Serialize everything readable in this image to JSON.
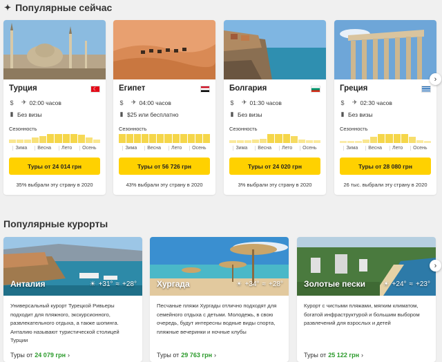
{
  "popular_now": {
    "title": "Популярные сейчас",
    "icon": "sparkle-star-icon",
    "cards": [
      {
        "name": "Турция",
        "flag_colors": [
          "#e30a17"
        ],
        "price_label": "",
        "flight": "02:00 часов",
        "visa": "Без визы",
        "season_label": "Сезонность",
        "season_levels": [
          0.4,
          0.4,
          0.4,
          0.6,
          0.8,
          1,
          1,
          1,
          1,
          0.9,
          0.6,
          0.4
        ],
        "months": [
          "Зима",
          "Весна",
          "Лето",
          "Осень"
        ],
        "button": "Туры от 24 014 грн",
        "chosen": "35% выбрали эту страну в 2020"
      },
      {
        "name": "Египет",
        "flag_colors": [
          "#ce1126",
          "#ffffff",
          "#000000"
        ],
        "price_label": "",
        "flight": "04:00 часов",
        "visa": "$25 или бесплатно",
        "season_label": "Сезонность",
        "season_levels": [
          1,
          1,
          1,
          1,
          1,
          1,
          1,
          1,
          1,
          1,
          1,
          1
        ],
        "months": [
          "Зима",
          "Весна",
          "Лето",
          "Осень"
        ],
        "button": "Туры от 56 726 грн",
        "chosen": "43% выбрали эту страну в 2020"
      },
      {
        "name": "Болгария",
        "flag_colors": [
          "#ffffff",
          "#00966e",
          "#d62612"
        ],
        "price_label": "",
        "flight": "01:30 часов",
        "visa": "Без визы",
        "season_label": "Сезонность",
        "season_levels": [
          0.3,
          0.3,
          0.3,
          0.4,
          0.5,
          1,
          1,
          1,
          0.8,
          0.4,
          0.3,
          0.3
        ],
        "months": [
          "Зима",
          "Весна",
          "Лето",
          "Осень"
        ],
        "button": "Туры от 24 020 грн",
        "chosen": "3% выбрали эту страну в 2020"
      },
      {
        "name": "Греция",
        "flag_colors": [
          "#0d5eaf",
          "#ffffff"
        ],
        "price_label": "",
        "flight": "02:30 часов",
        "visa": "Без визы",
        "season_label": "Сезонность",
        "season_levels": [
          0.2,
          0.2,
          0.2,
          0.4,
          0.7,
          1,
          1,
          1,
          1,
          0.7,
          0.3,
          0.2
        ],
        "months": [
          "Зима",
          "Весна",
          "Лето",
          "Осень"
        ],
        "button": "Туры от 28 080 грн",
        "chosen": "26 тыс. выбрали эту страну в 2020"
      }
    ]
  },
  "popular_resorts": {
    "title": "Популярные курорты",
    "cards": [
      {
        "name": "Анталия",
        "day_temp": "+31°",
        "water_temp": "+28°",
        "desc": "Универсальный курорт Турецкой Ривьеры подходит для пляжного, экскурсионного, развлекательного отдыха, а также шопинга. Анталию называют туристической столицей Турции",
        "price_prefix": "Туры от",
        "price": "24 079 грн"
      },
      {
        "name": "Хургада",
        "day_temp": "+34°",
        "water_temp": "+28°",
        "desc": "Песчаные пляжи Хургады отлично подходят для семейного отдыха с детьми. Молодежь, в свою очередь, будут интересны водные виды спорта, пляжные вечеринки и ночные клубы",
        "price_prefix": "Туры от",
        "price": "29 763 грн"
      },
      {
        "name": "Золотые пески",
        "day_temp": "+24°",
        "water_temp": "+23°",
        "desc": "Курорт с чистыми пляжами, мягким климатом, богатой инфраструктурой и большим выбором развлечений для взрослых и детей",
        "price_prefix": "Туры от",
        "price": "25 122 грн"
      }
    ]
  },
  "icons": {
    "dollar": "dollar-icon",
    "plane": "plane-icon",
    "passport": "passport-icon",
    "sun": "sun-icon",
    "waves": "waves-icon",
    "next": "chevron-right-icon"
  },
  "colors": {
    "button_yellow": "#ffd100",
    "season_bar": "#f5d64a",
    "price_green": "#2a9a2a"
  }
}
